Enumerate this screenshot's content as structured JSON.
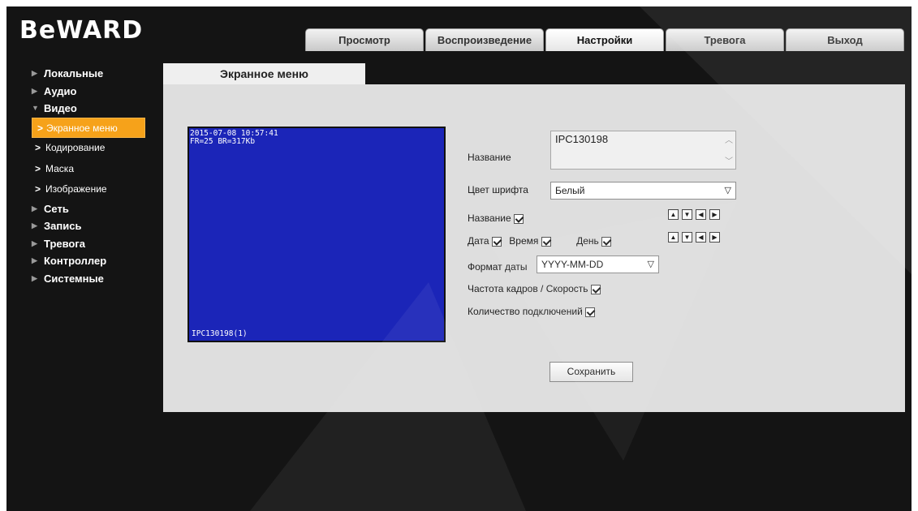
{
  "app": {
    "logo": "BeWARD"
  },
  "topnav": {
    "tabs": [
      {
        "label": "Просмотр"
      },
      {
        "label": "Воспроизведение"
      },
      {
        "label": "Настройки"
      },
      {
        "label": "Тревога"
      },
      {
        "label": "Выход"
      }
    ],
    "active": "Настройки"
  },
  "sidebar": {
    "items": [
      {
        "label": "Локальные"
      },
      {
        "label": "Аудио"
      },
      {
        "label": "Видео"
      },
      {
        "label": "Экранное меню"
      },
      {
        "label": "Кодирование"
      },
      {
        "label": "Маска"
      },
      {
        "label": "Изображение"
      },
      {
        "label": "Сеть"
      },
      {
        "label": "Запись"
      },
      {
        "label": "Тревога"
      },
      {
        "label": "Контроллер"
      },
      {
        "label": "Системные"
      }
    ]
  },
  "content": {
    "tab_title": "Экранное меню",
    "preview": {
      "osd_line1": "2015-07-08 10:57:41",
      "osd_line2": "FR=25 BR=317Kb",
      "osd_name": "IPC130198(1)"
    },
    "form": {
      "name_label": "Название",
      "name_value": "IPC130198",
      "font_color_label": "Цвет шрифта",
      "font_color_value": "Белый",
      "show_name_label": "Название",
      "date_label": "Дата",
      "time_label": "Время",
      "day_label": "День",
      "date_format_label": "Формат даты",
      "date_format_value": "YYYY-MM-DD",
      "framerate_label": "Частота кадров / Скорость",
      "connections_label": "Количество подключений",
      "save_label": "Сохранить"
    }
  },
  "colors": {
    "accent": "#f6a21a",
    "background": "#141414",
    "panel": "#dedede",
    "preview": "#1b25b8"
  }
}
